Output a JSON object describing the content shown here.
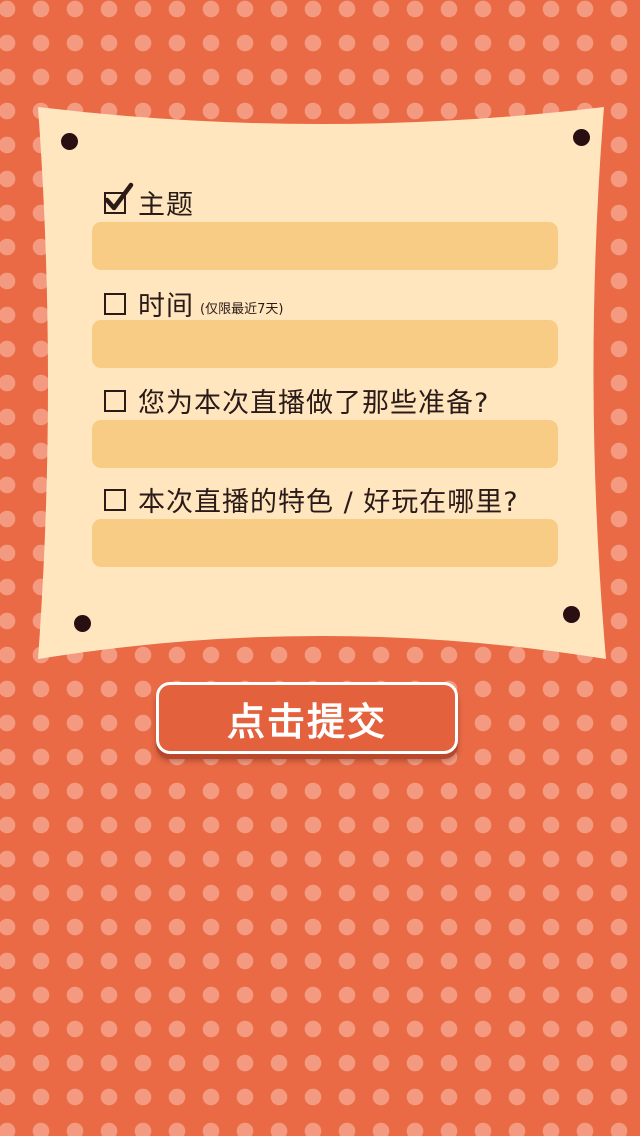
{
  "form": {
    "fields": [
      {
        "label": "主题",
        "note": "",
        "checked": true
      },
      {
        "label": "时间",
        "note": "(仅限最近7天)",
        "checked": false
      },
      {
        "label": "您为本次直播做了那些准备?",
        "note": "",
        "checked": false
      },
      {
        "label": "本次直播的特色 / 好玩在哪里?",
        "note": "",
        "checked": false
      }
    ]
  },
  "submit": {
    "label": "点击提交"
  },
  "colors": {
    "background": "#E96A45",
    "dots": "#F49A80",
    "card": "#FFE6BF",
    "input": "#F9CC86",
    "button": "#E4613E"
  },
  "icons": {
    "checkbox_checked": "checkmark-icon"
  }
}
